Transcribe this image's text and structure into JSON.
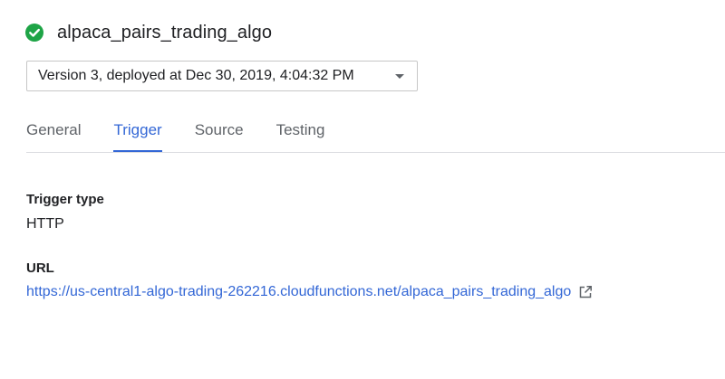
{
  "header": {
    "status_icon": "check-circle-icon",
    "status_color": "#1ea446",
    "function_name": "alpaca_pairs_trading_algo"
  },
  "version_select": {
    "selected_value": "Version 3, deployed at Dec 30, 2019, 4:04:32 PM",
    "arrow_icon": "dropdown-arrow-icon"
  },
  "tabs": [
    {
      "label": "General",
      "active": false
    },
    {
      "label": "Trigger",
      "active": true
    },
    {
      "label": "Source",
      "active": false
    },
    {
      "label": "Testing",
      "active": false
    }
  ],
  "trigger": {
    "type_label": "Trigger type",
    "type_value": "HTTP",
    "url_label": "URL",
    "url_value": "https://us-central1-algo-trading-262216.cloudfunctions.net/alpaca_pairs_trading_algo",
    "external_icon": "open-in-new-icon"
  },
  "colors": {
    "accent": "#3367d6",
    "text_primary": "#202124",
    "text_secondary": "#5f6368",
    "divider": "#dadce0"
  }
}
